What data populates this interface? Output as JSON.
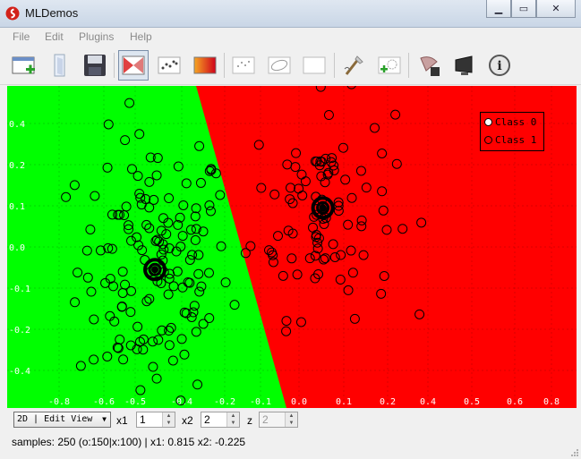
{
  "window": {
    "title": "MLDemos"
  },
  "menu": [
    "File",
    "Edit",
    "Plugins",
    "Help"
  ],
  "toolbar": {
    "tools": [
      "new-dataset-icon",
      "open-file-icon",
      "save-icon",
      "classification-icon",
      "scatter-plot-icon",
      "heatmap-icon",
      "draw-samples-icon",
      "draw-ellipse-icon",
      "blank-canvas-icon",
      "spray-brush-icon",
      "add-sample-icon",
      "export-icon",
      "display-icon",
      "info-icon"
    ]
  },
  "colors": {
    "class0_region": "#00ff00",
    "class1_region": "#ff0000",
    "marker": "#000000"
  },
  "legend": {
    "class0": "Class 0",
    "class1": "Class 1"
  },
  "chart_data": {
    "type": "scatter",
    "xlim": [
      -0.9,
      0.85
    ],
    "ylim": [
      -0.5,
      0.45
    ],
    "x_ticks": [
      "-0.8",
      "-0.6",
      "-0.5",
      "-0.4",
      "-0.2",
      "-0.1",
      "0.0",
      "0.1",
      "0.2",
      "0.4",
      "0.5",
      "0.6",
      "0.8"
    ],
    "y_ticks": [
      "0.4",
      "0.2",
      "0.1",
      "0.0",
      "-0.1",
      "-0.2",
      "-0.4"
    ],
    "centroids": [
      {
        "name": "Class 0",
        "x": -0.495,
        "y": -0.055
      },
      {
        "name": "Class 1",
        "x": 0.12,
        "y": 0.095
      }
    ]
  },
  "bottom": {
    "view_select": "2D | Edit View",
    "x1_label": "x1",
    "x1_value": "1",
    "x2_label": "x2",
    "x2_value": "2",
    "z_label": "z",
    "z_value": "2"
  },
  "status": "samples: 250 (o:150|x:100) | x1: 0.815 x2: -0.225"
}
